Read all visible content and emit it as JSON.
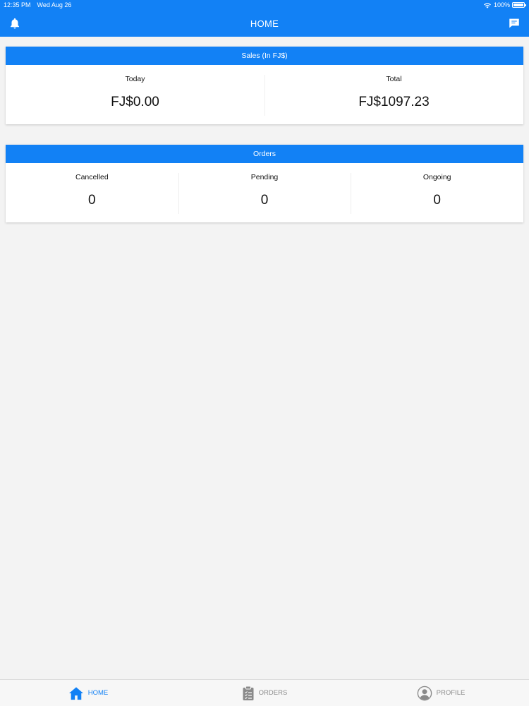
{
  "status_bar": {
    "time": "12:35 PM",
    "date": "Wed Aug 26",
    "battery_text": "100%",
    "battery_level": 1.0
  },
  "header": {
    "title": "HOME",
    "left_icon": "bell-icon",
    "right_icon": "chat-icon"
  },
  "sales": {
    "title": "Sales (In FJ$)",
    "items": [
      {
        "label": "Today",
        "value": "FJ$0.00"
      },
      {
        "label": "Total",
        "value": "FJ$1097.23"
      }
    ]
  },
  "orders": {
    "title": "Orders",
    "items": [
      {
        "label": "Cancelled",
        "value": "0"
      },
      {
        "label": "Pending",
        "value": "0"
      },
      {
        "label": "Ongoing",
        "value": "0"
      }
    ]
  },
  "tabs": [
    {
      "label": "HOME",
      "icon": "home-icon",
      "active": true
    },
    {
      "label": "ORDERS",
      "icon": "clipboard-icon",
      "active": false
    },
    {
      "label": "PROFILE",
      "icon": "profile-icon",
      "active": false
    }
  ],
  "colors": {
    "primary": "#1281f5",
    "background": "#f3f3f3",
    "inactive_tab": "#8a8a8a"
  }
}
